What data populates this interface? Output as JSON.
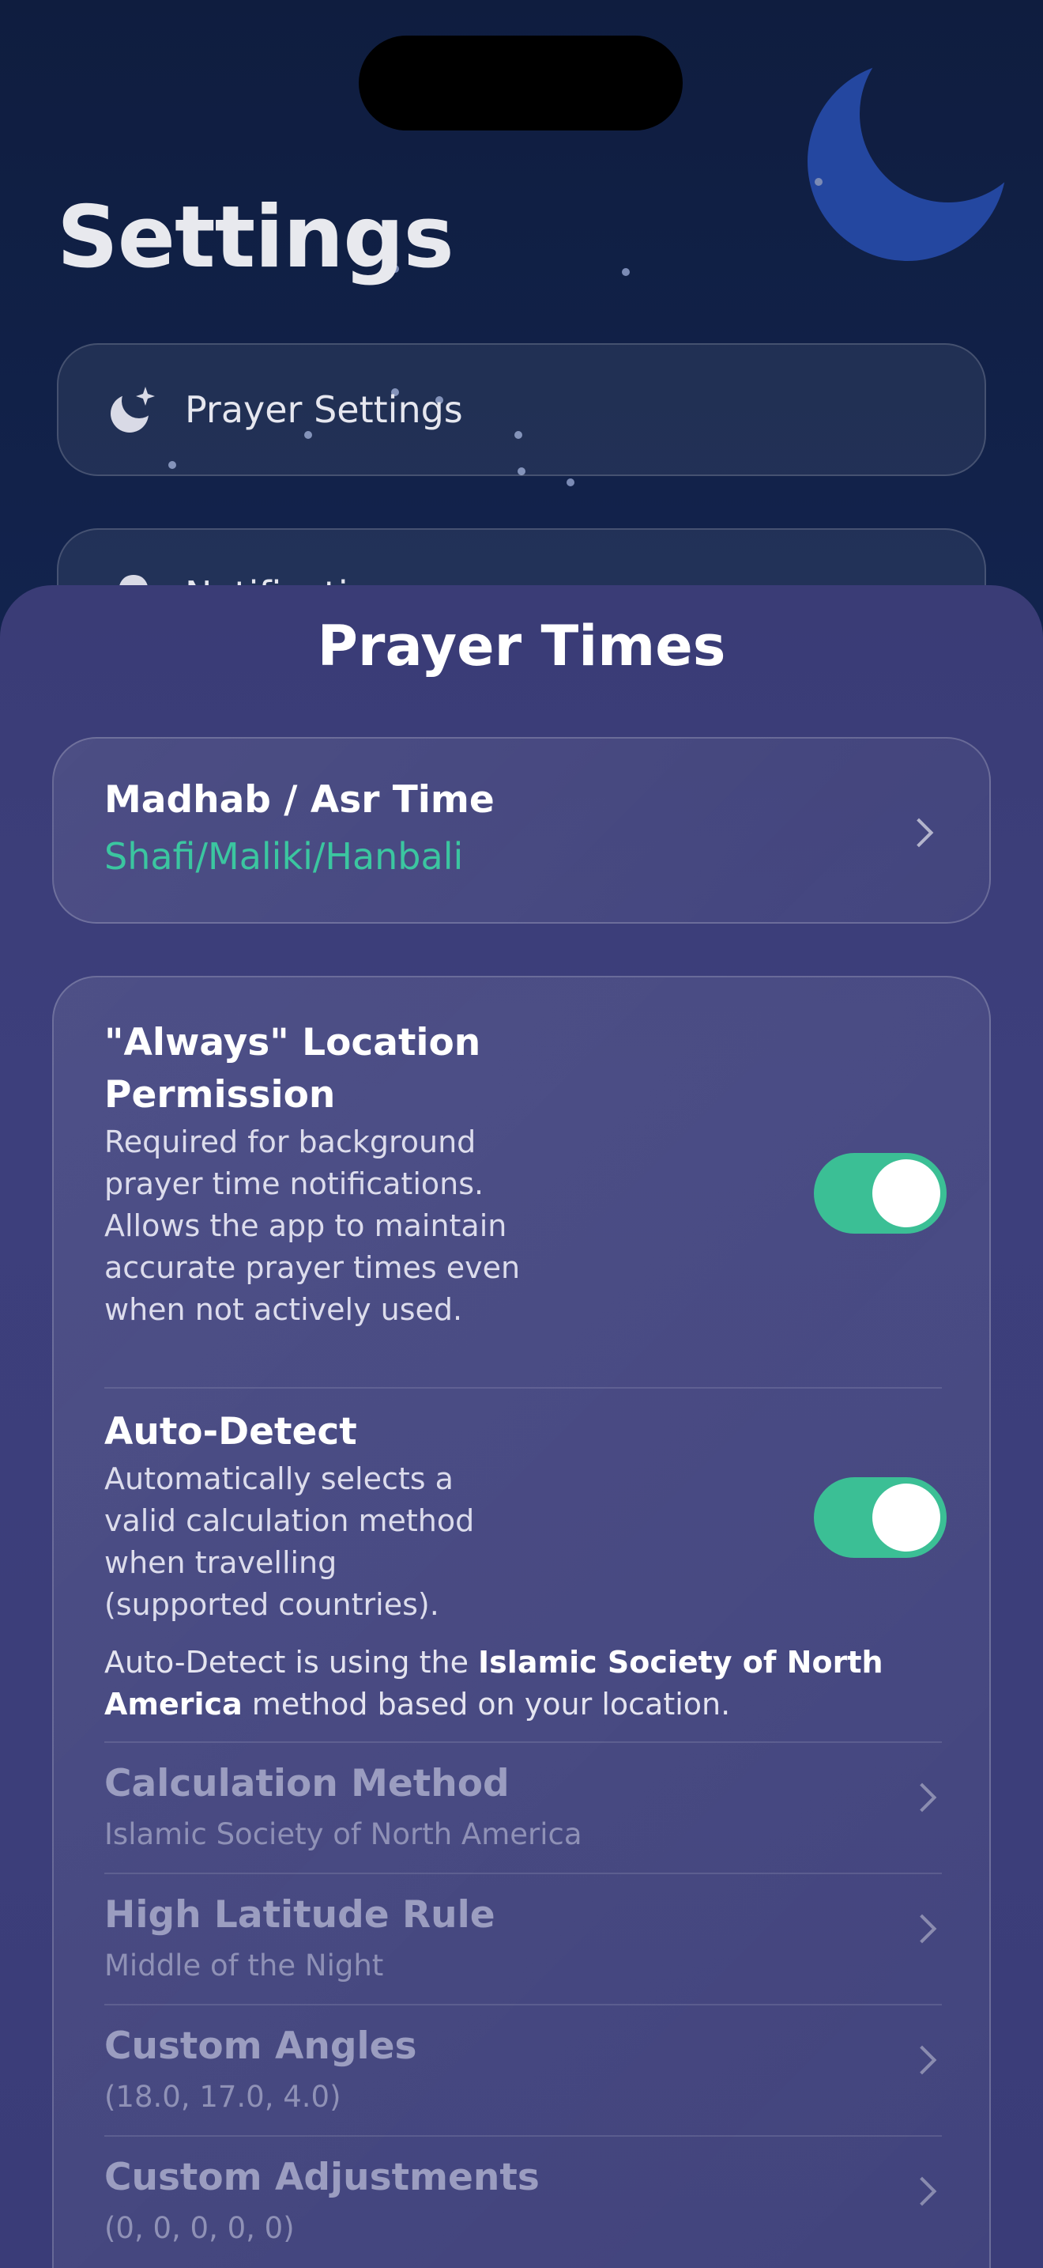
{
  "background": {
    "title": "Settings",
    "rows": [
      {
        "label": "Prayer Settings",
        "icon": "moon-stars-icon"
      },
      {
        "label": "Notifications",
        "icon": "bell-icon"
      }
    ]
  },
  "sheet": {
    "title": "Prayer Times",
    "madhab": {
      "title": "Madhab / Asr Time",
      "value": "Shafi/Maliki/Hanbali",
      "value_color": "#3bc6a0"
    },
    "location_permission": {
      "title": "\"Always\" Location Permission",
      "description": "Required for background prayer time notifications. Allows the app to maintain accurate prayer times even when not actively used.",
      "enabled": true
    },
    "auto_detect": {
      "title": "Auto-Detect",
      "description": "Automatically selects a valid calculation method when travelling (supported countries).",
      "enabled": true,
      "note_prefix": "Auto-Detect is using the ",
      "note_method": "Islamic Society of North America",
      "note_suffix": " method based on your location."
    },
    "options": [
      {
        "title": "Calculation Method",
        "value": "Islamic Society of North America"
      },
      {
        "title": "High Latitude Rule",
        "value": "Middle of the Night"
      },
      {
        "title": "Custom Angles",
        "value": "(18.0, 17.0, 4.0)"
      },
      {
        "title": "Custom Adjustments",
        "value": "(0, 0, 0, 0, 0)"
      }
    ]
  },
  "colors": {
    "toggle_on": "#3bbf95",
    "accent_green": "#3bc6a0"
  }
}
